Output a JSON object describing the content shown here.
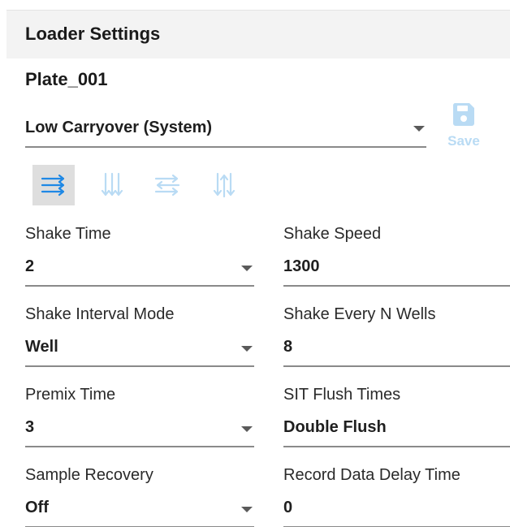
{
  "header": {
    "title": "Loader Settings"
  },
  "plate": {
    "name": "Plate_001"
  },
  "method": {
    "selected": "Low Carryover (System)"
  },
  "save": {
    "label": "Save"
  },
  "toolbar": {
    "icons": [
      "arrows-right-icon",
      "arrows-down-icon",
      "arrows-swap-icon",
      "arrows-updown-icon"
    ],
    "active_index": 0
  },
  "fields": {
    "shake_time": {
      "label": "Shake Time",
      "value": "2"
    },
    "shake_speed": {
      "label": "Shake Speed",
      "value": "1300"
    },
    "shake_interval_mode": {
      "label": "Shake Interval Mode",
      "value": "Well"
    },
    "shake_every_n_wells": {
      "label": "Shake Every N Wells",
      "value": "8"
    },
    "premix_time": {
      "label": "Premix Time",
      "value": "3"
    },
    "sit_flush_times": {
      "label": "SIT Flush Times",
      "value": "Double Flush"
    },
    "sample_recovery": {
      "label": "Sample Recovery",
      "value": "Off"
    },
    "record_data_delay_time": {
      "label": "Record Data Delay Time",
      "value": "0"
    }
  },
  "colors": {
    "accent": "#1e88e5",
    "accent_light": "#b9dbf4",
    "active_tool_bg": "#dedede"
  }
}
